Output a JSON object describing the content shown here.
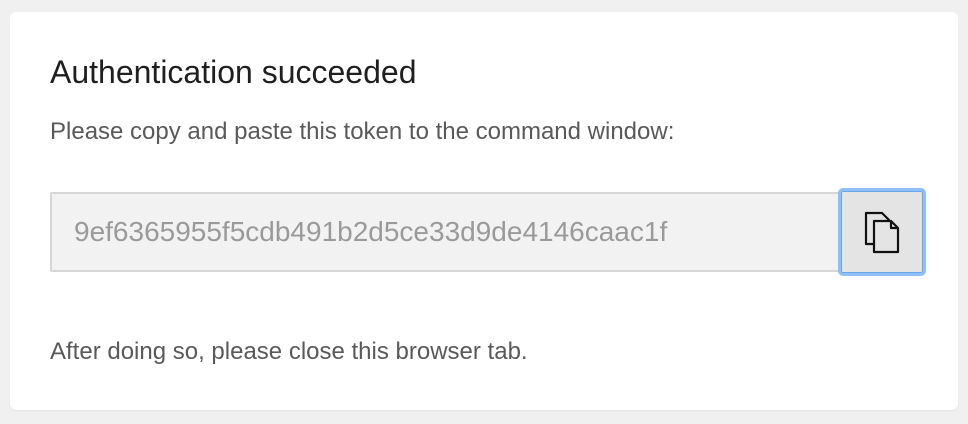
{
  "auth": {
    "title": "Authentication succeeded",
    "instruction": "Please copy and paste this token to the command window:",
    "token": "9ef6365955f5cdb491b2d5ce33d9de4146caac1f",
    "copy_icon": "copy-icon",
    "footer": "After doing so, please close this browser tab."
  },
  "colors": {
    "page_background": "#f0f0f0",
    "card_background": "#ffffff",
    "focus_ring": "#8fbff5"
  }
}
